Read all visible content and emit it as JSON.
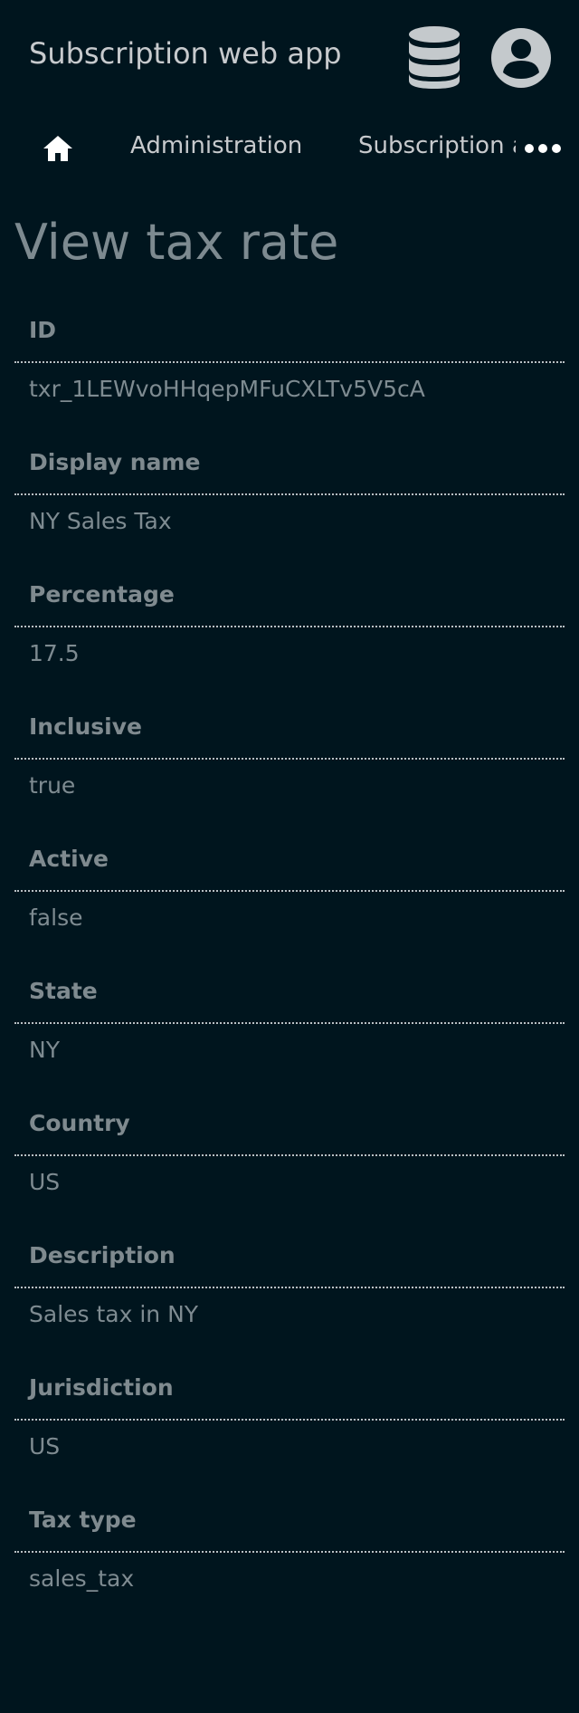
{
  "header": {
    "app_title": "Subscription web app",
    "database_icon": "database-icon",
    "account_icon": "user-circle-icon"
  },
  "breadcrumbs": {
    "home_icon": "home-icon",
    "items": [
      "Administration",
      "Subscription a"
    ],
    "more_icon": "more-horizontal-icon"
  },
  "page": {
    "title": "View tax rate"
  },
  "fields": [
    {
      "label": "ID",
      "value": "txr_1LEWvoHHqepMFuCXLTv5V5cA"
    },
    {
      "label": "Display name",
      "value": "NY Sales Tax"
    },
    {
      "label": "Percentage",
      "value": "17.5"
    },
    {
      "label": "Inclusive",
      "value": "true"
    },
    {
      "label": "Active",
      "value": "false"
    },
    {
      "label": "State",
      "value": "NY"
    },
    {
      "label": "Country",
      "value": "US"
    },
    {
      "label": "Description",
      "value": "Sales tax in NY"
    },
    {
      "label": "Jurisdiction",
      "value": "US"
    },
    {
      "label": "Tax type",
      "value": "sales_tax"
    }
  ],
  "colors": {
    "background": "#00151e",
    "icon": "#c4c9cc",
    "label": "#7f8a8f",
    "value": "#7e8b91",
    "title": "#7d8a90"
  }
}
